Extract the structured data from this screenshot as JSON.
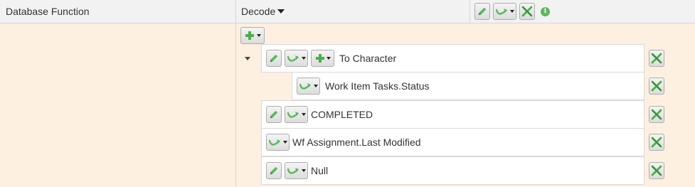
{
  "header": {
    "column1_title": "Database Function",
    "column2_title": "Decode",
    "column3_icons": [
      "pencil-icon",
      "transform-icon",
      "delete-icon",
      "info-icon"
    ],
    "info_glyph": "i"
  },
  "expression": {
    "root": {
      "label": "To Character",
      "child": {
        "label": "Work Item Tasks.Status"
      }
    },
    "items": [
      {
        "label": "COMPLETED"
      },
      {
        "label": "Wf Assignment.Last Modified"
      },
      {
        "label": "Null"
      }
    ]
  },
  "colors": {
    "accent_green": "#4cae4c",
    "row_background": "#fdf0e0",
    "header_background": "#f2f2f2"
  }
}
